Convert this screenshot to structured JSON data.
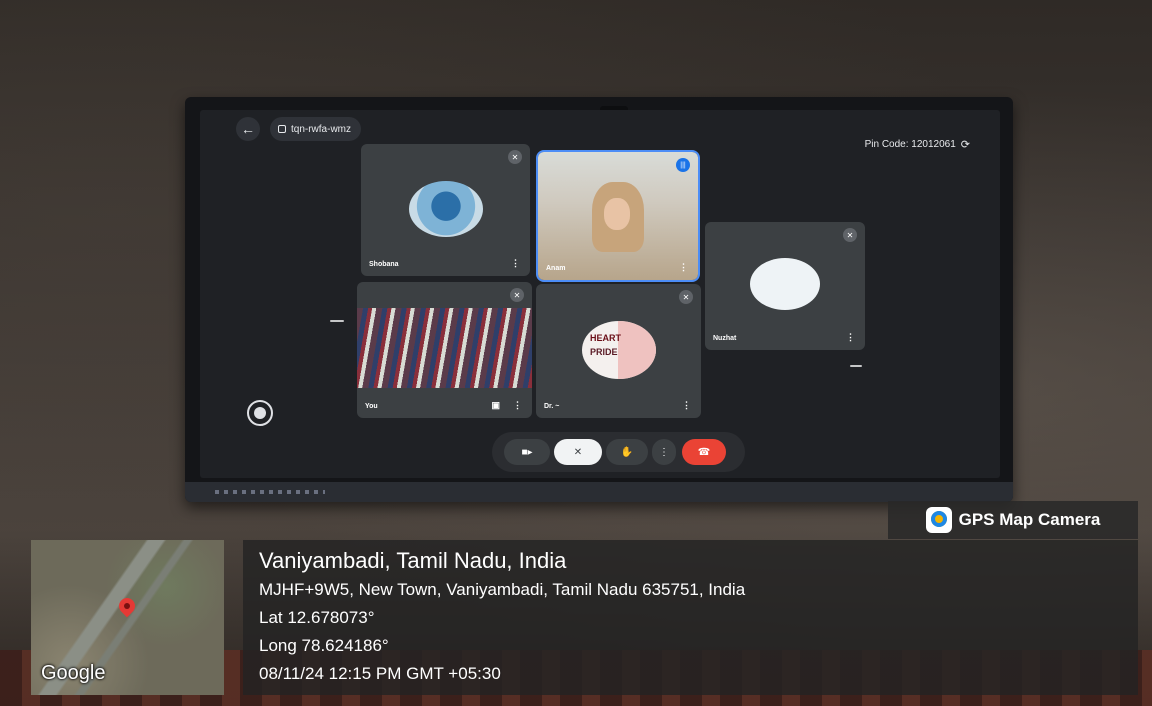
{
  "meet": {
    "meeting_code": "tqn-rwfa-wmz",
    "pin_code": "Pin Code: 12012061",
    "participants": [
      {
        "name": "Shobana",
        "muted": true
      },
      {
        "name": "Anam",
        "speaking": true
      },
      {
        "name": "Nuzhat",
        "muted": true
      },
      {
        "name": "You",
        "muted": true
      },
      {
        "name": "Dr. ~",
        "muted": true
      }
    ],
    "tile_text": {
      "heart": "HEART",
      "pride": "PRIDE"
    },
    "icons": {
      "back": "arrow-left-icon",
      "calendar": "calendar-icon",
      "camera": "camera-icon",
      "mic_off": "mic-off-icon",
      "hand": "raise-hand-icon",
      "more": "more-vert-icon",
      "end_call": "end-call-icon"
    },
    "colors": {
      "speaking": "#1a73e8",
      "leave": "#ea4335"
    }
  },
  "gps": {
    "app_name": "GPS Map Camera",
    "map_logo": "Google",
    "place": "Vaniyambadi, Tamil Nadu, India",
    "address": "MJHF+9W5, New Town, Vaniyambadi, Tamil Nadu 635751, India",
    "lat": "Lat 12.678073°",
    "long": "Long 78.624186°",
    "datetime": "08/11/24 12:15 PM GMT +05:30"
  }
}
